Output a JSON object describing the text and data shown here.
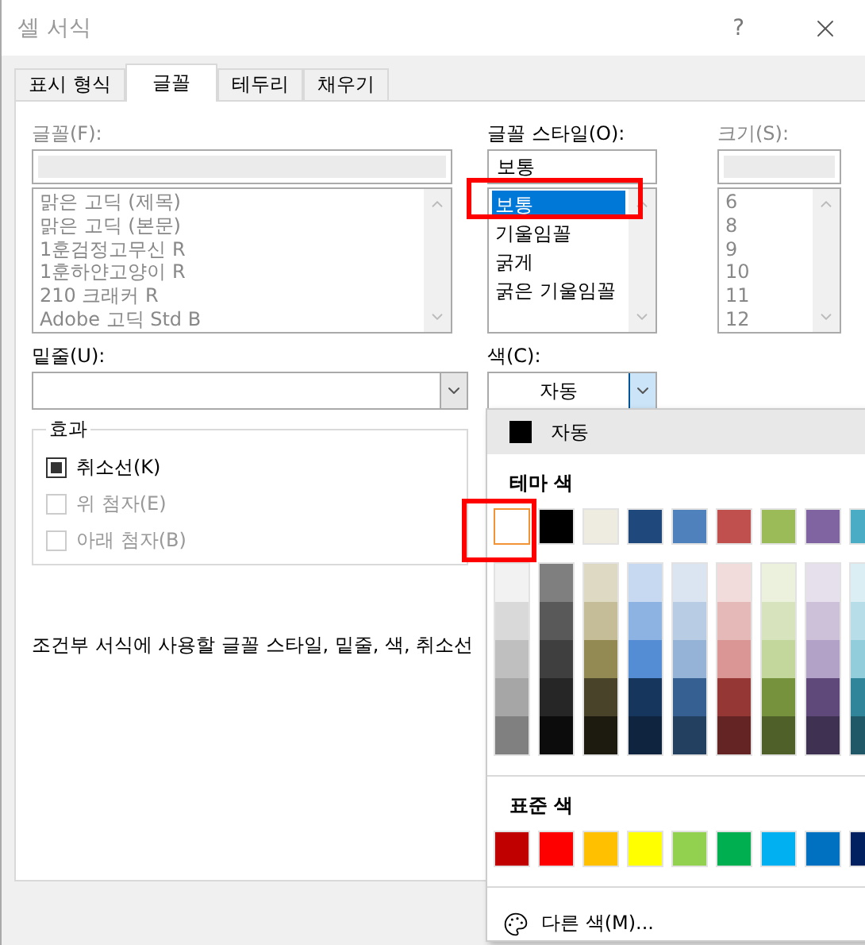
{
  "window": {
    "title": "셀 서식",
    "help": "?"
  },
  "tabs": [
    {
      "label": "표시 형식",
      "selected": false
    },
    {
      "label": "글꼴",
      "selected": true
    },
    {
      "label": "테두리",
      "selected": false
    },
    {
      "label": "채우기",
      "selected": false
    }
  ],
  "font": {
    "label": "글꼴(F):",
    "items": [
      "맑은 고딕 (제목)",
      "맑은 고딕 (본문)",
      "1훈검정고무신 R",
      "1훈하얀고양이 R",
      "210 크래커 R",
      "Adobe 고딕 Std B"
    ]
  },
  "font_style": {
    "label": "글꼴 스타일(O):",
    "value": "보통",
    "items": [
      {
        "label": "보통",
        "selected": true
      },
      {
        "label": "기울임꼴",
        "selected": false
      },
      {
        "label": "굵게",
        "selected": false
      },
      {
        "label": "굵은 기울임꼴",
        "selected": false
      }
    ]
  },
  "size": {
    "label": "크기(S):",
    "items": [
      "6",
      "8",
      "9",
      "10",
      "11",
      "12"
    ]
  },
  "underline": {
    "label": "밑줄(U):"
  },
  "color": {
    "label": "색(C):",
    "value": "자동"
  },
  "effects": {
    "title": "효과",
    "items": [
      {
        "label": "취소선(K)",
        "checked": true,
        "disabled": false
      },
      {
        "label": "위 첨자(E)",
        "checked": false,
        "disabled": true
      },
      {
        "label": "아래 첨자(B)",
        "checked": false,
        "disabled": true
      }
    ]
  },
  "description": "조건부 서식에 사용할 글꼴 스타일, 밑줄, 색, 취소선",
  "color_menu": {
    "automatic": {
      "label": "자동",
      "color": "#000000"
    },
    "theme_title": "테마 색",
    "theme_colors": [
      {
        "color": "#ffffff",
        "selected": true
      },
      {
        "color": "#000000",
        "selected": false
      },
      {
        "color": "#eeece1",
        "selected": false
      },
      {
        "color": "#1f497d",
        "selected": false
      },
      {
        "color": "#4f81bd",
        "selected": false
      },
      {
        "color": "#c0504d",
        "selected": false
      },
      {
        "color": "#9bbb59",
        "selected": false
      },
      {
        "color": "#8064a2",
        "selected": false
      },
      {
        "color": "#4bacc6",
        "selected": false
      }
    ],
    "theme_shades": [
      [
        {
          "color": "#f2f2f2"
        },
        {
          "color": "#d9d9d9"
        },
        {
          "color": "#bfbfbf"
        },
        {
          "color": "#a6a6a6"
        },
        {
          "color": "#808080"
        }
      ],
      [
        {
          "color": "#7f7f7f"
        },
        {
          "color": "#595959"
        },
        {
          "color": "#3f3f3f"
        },
        {
          "color": "#262626"
        },
        {
          "color": "#0c0c0c"
        }
      ],
      [
        {
          "color": "#ddd9c3"
        },
        {
          "color": "#c4bd97"
        },
        {
          "color": "#938953"
        },
        {
          "color": "#494429"
        },
        {
          "color": "#1d1b10"
        }
      ],
      [
        {
          "color": "#c6d9f0"
        },
        {
          "color": "#8db3e2"
        },
        {
          "color": "#548dd4"
        },
        {
          "color": "#17365d"
        },
        {
          "color": "#0f243e"
        }
      ],
      [
        {
          "color": "#dbe5f1"
        },
        {
          "color": "#b8cce4"
        },
        {
          "color": "#95b3d7"
        },
        {
          "color": "#366092"
        },
        {
          "color": "#244061"
        }
      ],
      [
        {
          "color": "#f2dcdb"
        },
        {
          "color": "#e5b9b7"
        },
        {
          "color": "#d99694"
        },
        {
          "color": "#953734"
        },
        {
          "color": "#632423"
        }
      ],
      [
        {
          "color": "#ebf1dd"
        },
        {
          "color": "#d7e3bc"
        },
        {
          "color": "#c3d69b"
        },
        {
          "color": "#76923c"
        },
        {
          "color": "#4f6128"
        }
      ],
      [
        {
          "color": "#e5e0ec"
        },
        {
          "color": "#ccc1d9"
        },
        {
          "color": "#b2a2c7"
        },
        {
          "color": "#5f497a"
        },
        {
          "color": "#3f3151"
        }
      ],
      [
        {
          "color": "#dbeef3"
        },
        {
          "color": "#b7dde8"
        },
        {
          "color": "#92cddc"
        },
        {
          "color": "#31859b"
        },
        {
          "color": "#205867"
        }
      ]
    ],
    "standard_title": "표준 색",
    "standard_colors": [
      {
        "color": "#c00000"
      },
      {
        "color": "#ff0000"
      },
      {
        "color": "#ffc000"
      },
      {
        "color": "#ffff00"
      },
      {
        "color": "#92d050"
      },
      {
        "color": "#00b050"
      },
      {
        "color": "#00b0f0"
      },
      {
        "color": "#0070c0"
      },
      {
        "color": "#002060"
      }
    ],
    "more": "다른 색(M)..."
  }
}
